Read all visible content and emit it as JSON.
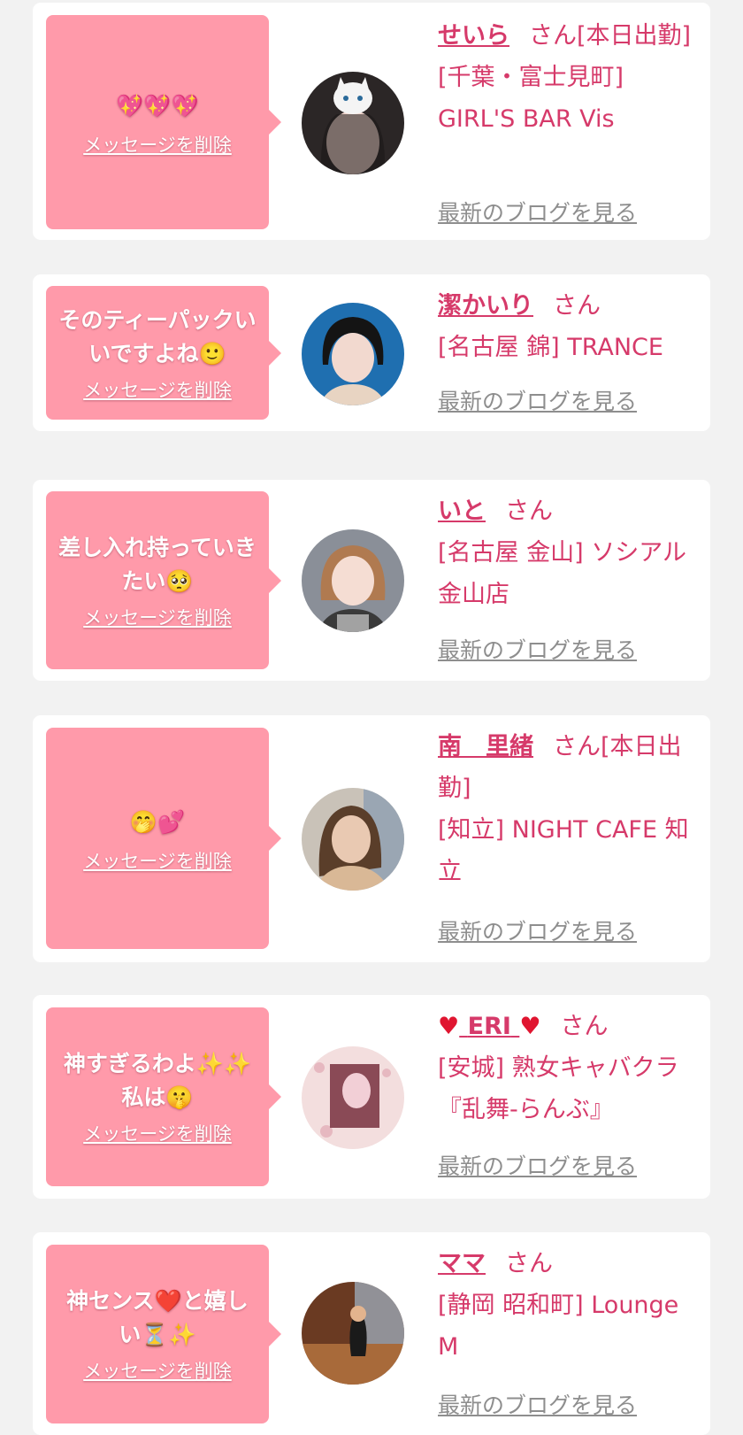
{
  "colors": {
    "page_bg": "#f2f2f2",
    "card_bg": "#ffffff",
    "bubble_bg": "#ff9aaa",
    "accent_text": "#d63a6a",
    "link_gray": "#8e8e8e"
  },
  "common": {
    "delete_label": "メッセージを削除",
    "blog_label": "最新のブログを見る"
  },
  "entries": [
    {
      "message": "💖💖💖",
      "name": "せいら",
      "honorific": "さん[本日出勤]",
      "shop": "[千葉・富士見町] GIRL'S BAR Vis"
    },
    {
      "message": "そのティーパックいいですよね🙂",
      "name": "潔かいり",
      "honorific": "さん",
      "shop": "[名古屋 錦] TRANCE"
    },
    {
      "message": "差し入れ持っていきたい🥺",
      "name": "いと",
      "honorific": "さん",
      "shop": "[名古屋 金山] ソシアル金山店"
    },
    {
      "message": "🤭💕",
      "name": "南　里緒",
      "honorific": "さん[本日出勤]",
      "shop": "[知立] NIGHT CAFE 知立"
    },
    {
      "message": "神すぎるわよ✨✨私は🤫",
      "name": "ERI",
      "name_icon": "heart-icon",
      "honorific": "さん",
      "shop": "[安城] 熟女キャバクラ『乱舞-らんぶ』"
    },
    {
      "message": "神センス❤️と嬉しい⏳✨",
      "name": "ママ",
      "honorific": "さん",
      "shop": "[静岡 昭和町] Lounge M"
    }
  ]
}
